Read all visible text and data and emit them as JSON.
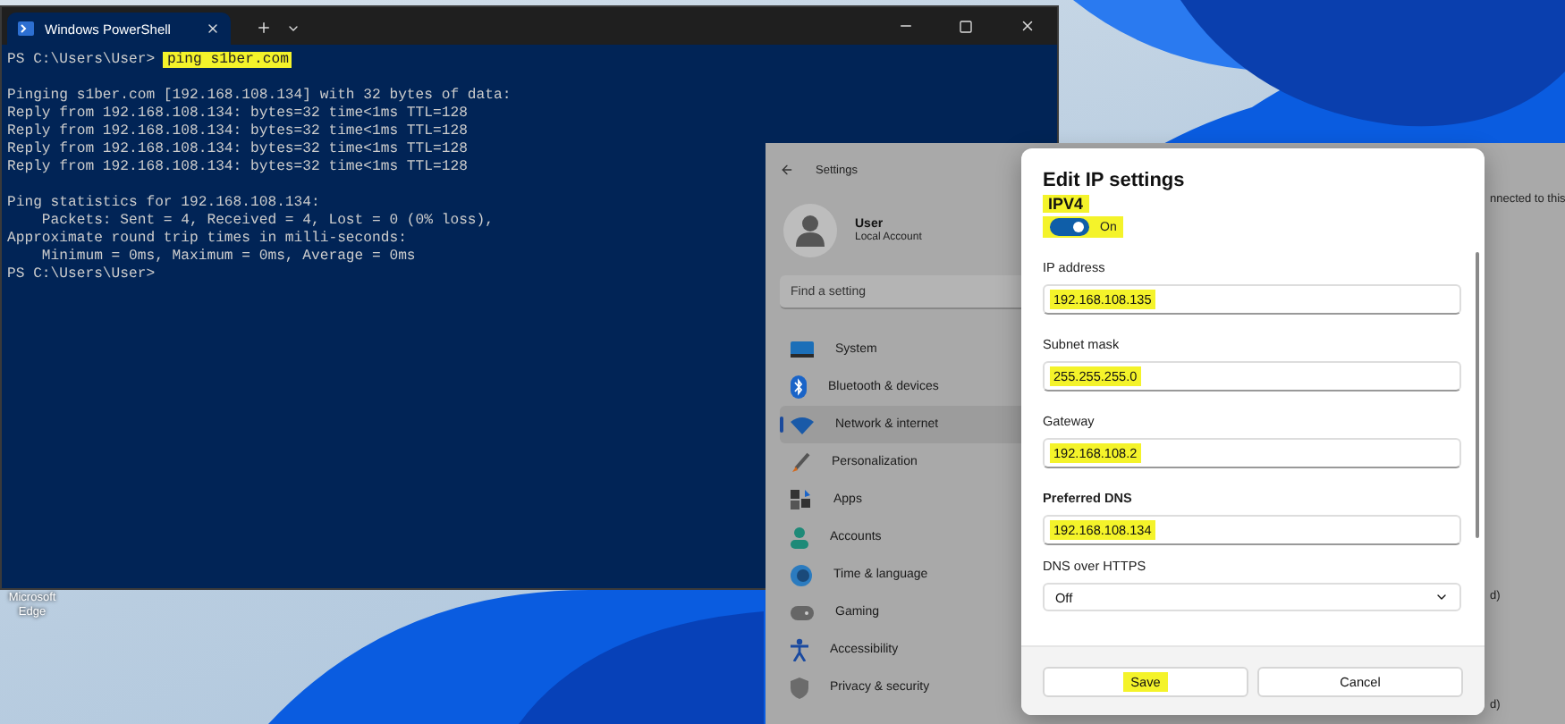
{
  "desktop": {
    "icons": [
      {
        "label": "Microsoft Edge"
      }
    ]
  },
  "powershell": {
    "tab": {
      "title": "Windows PowerShell",
      "selected": true
    },
    "console": {
      "blocks": [
        [
          {
            "prompt": "PS C:\\Users\\User>",
            "command": "ping s1ber.com",
            "highlighted": true
          }
        ],
        [
          {
            "text": "Pinging s1ber.com [192.168.108.134] with 32 bytes of data:"
          },
          {
            "text": "Reply from 192.168.108.134: bytes=32 time<1ms TTL=128"
          },
          {
            "text": "Reply from 192.168.108.134: bytes=32 time<1ms TTL=128"
          },
          {
            "text": "Reply from 192.168.108.134: bytes=32 time<1ms TTL=128"
          },
          {
            "text": "Reply from 192.168.108.134: bytes=32 time<1ms TTL=128"
          }
        ],
        [
          {
            "text": "Ping statistics for 192.168.108.134:"
          },
          {
            "text": "    Packets: Sent = 4, Received = 4, Lost = 0 (0% loss),"
          },
          {
            "text": "Approximate round trip times in milli-seconds:"
          },
          {
            "text": "    Minimum = 0ms, Maximum = 0ms, Average = 0ms"
          },
          {
            "prompt": "PS C:\\Users\\User>"
          }
        ]
      ]
    }
  },
  "settings": {
    "title": "Settings",
    "account": {
      "name": "User",
      "type": "Local Account"
    },
    "search": {
      "placeholder": "Find a setting"
    },
    "nav": [
      {
        "label": "System",
        "selected": false
      },
      {
        "label": "Bluetooth & devices",
        "selected": false
      },
      {
        "label": "Network & internet",
        "selected": true
      },
      {
        "label": "Personalization",
        "selected": false
      },
      {
        "label": "Apps",
        "selected": false
      },
      {
        "label": "Accounts",
        "selected": false
      },
      {
        "label": "Time & language",
        "selected": false
      },
      {
        "label": "Gaming",
        "selected": false
      },
      {
        "label": "Accessibility",
        "selected": false
      },
      {
        "label": "Privacy & security",
        "selected": false
      }
    ],
    "content_fragments": [
      "nnected to this",
      "d)",
      "d)"
    ]
  },
  "dialog": {
    "title": "Edit IP settings",
    "section": "IPV4",
    "section_highlighted": true,
    "toggle": {
      "on": true,
      "label": "On",
      "highlighted": true
    },
    "fields": [
      {
        "label": "IP address",
        "value": "192.168.108.135",
        "bold": false,
        "highlighted": true
      },
      {
        "label": "Subnet mask",
        "value": "255.255.255.0",
        "bold": false,
        "highlighted": true
      },
      {
        "label": "Gateway",
        "value": "192.168.108.2",
        "bold": false,
        "highlighted": true
      },
      {
        "label": "Preferred DNS",
        "value": "192.168.108.134",
        "bold": true,
        "highlighted": true
      }
    ],
    "dropdown": {
      "label": "DNS over HTTPS",
      "value": "Off"
    },
    "buttons": [
      {
        "label": "Save",
        "highlighted": true
      },
      {
        "label": "Cancel",
        "highlighted": false
      }
    ]
  }
}
